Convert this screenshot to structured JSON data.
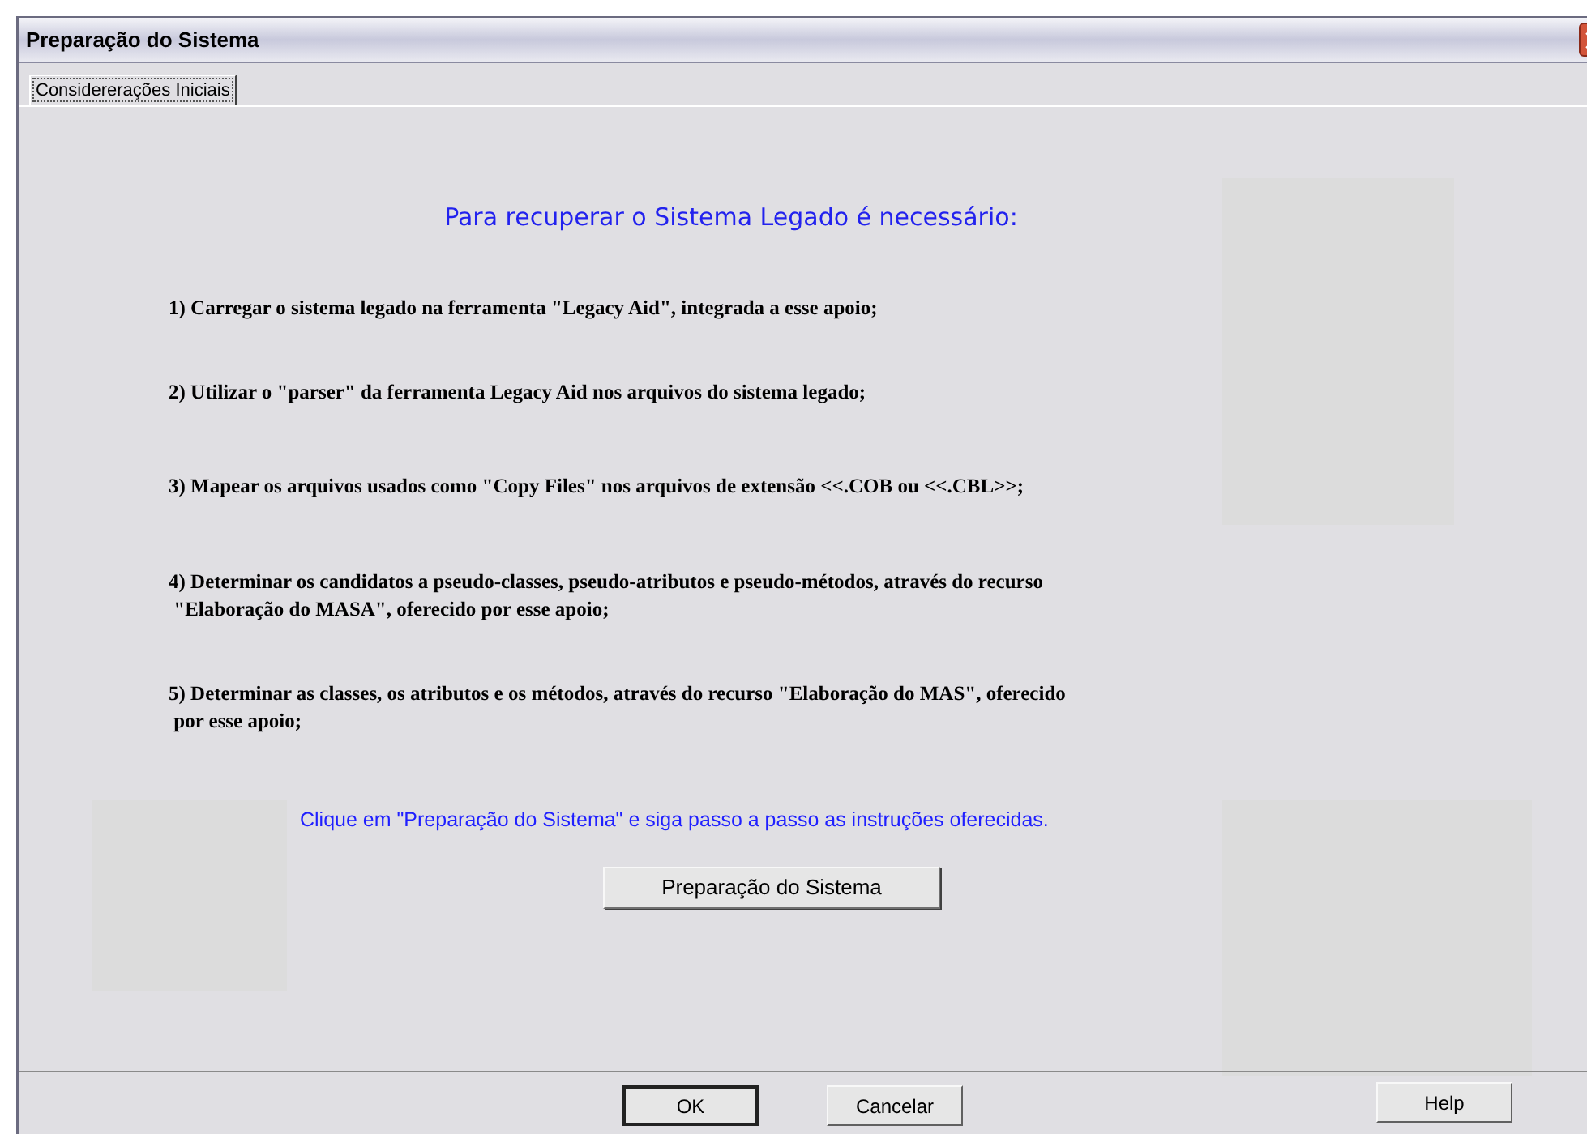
{
  "window": {
    "title": "Preparação do Sistema"
  },
  "tabs": [
    {
      "label": "Considererações Iniciais",
      "selected": true
    }
  ],
  "heading": "Para recuperar o Sistema Legado é necessário:",
  "steps": [
    {
      "text": "1) Carregar o sistema legado na ferramenta \"Legacy Aid\", integrada a esse apoio;"
    },
    {
      "text": "2) Utilizar o \"parser\" da ferramenta Legacy Aid nos arquivos do sistema legado;"
    },
    {
      "text": "3) Mapear os arquivos usados como \"Copy Files\" nos arquivos de extensão <<.COB ou <<.CBL>>;"
    },
    {
      "text": "4) Determinar os candidatos a pseudo-classes, pseudo-atributos e pseudo-métodos, através do recurso\n \"Elaboração do MASA\", oferecido por esse apoio;"
    },
    {
      "text": "5) Determinar as classes, os atributos e os métodos, através do recurso \"Elaboração do MAS\", oferecido\n por esse apoio;"
    }
  ],
  "instruction": "Clique em \"Preparação do Sistema\" e siga passo a passo as instruções oferecidas.",
  "action_button": "Preparação do Sistema",
  "footer_buttons": [
    {
      "label": "OK",
      "default": true
    },
    {
      "label": "Cancelar",
      "default": false
    },
    {
      "label": "Help",
      "default": false
    }
  ]
}
